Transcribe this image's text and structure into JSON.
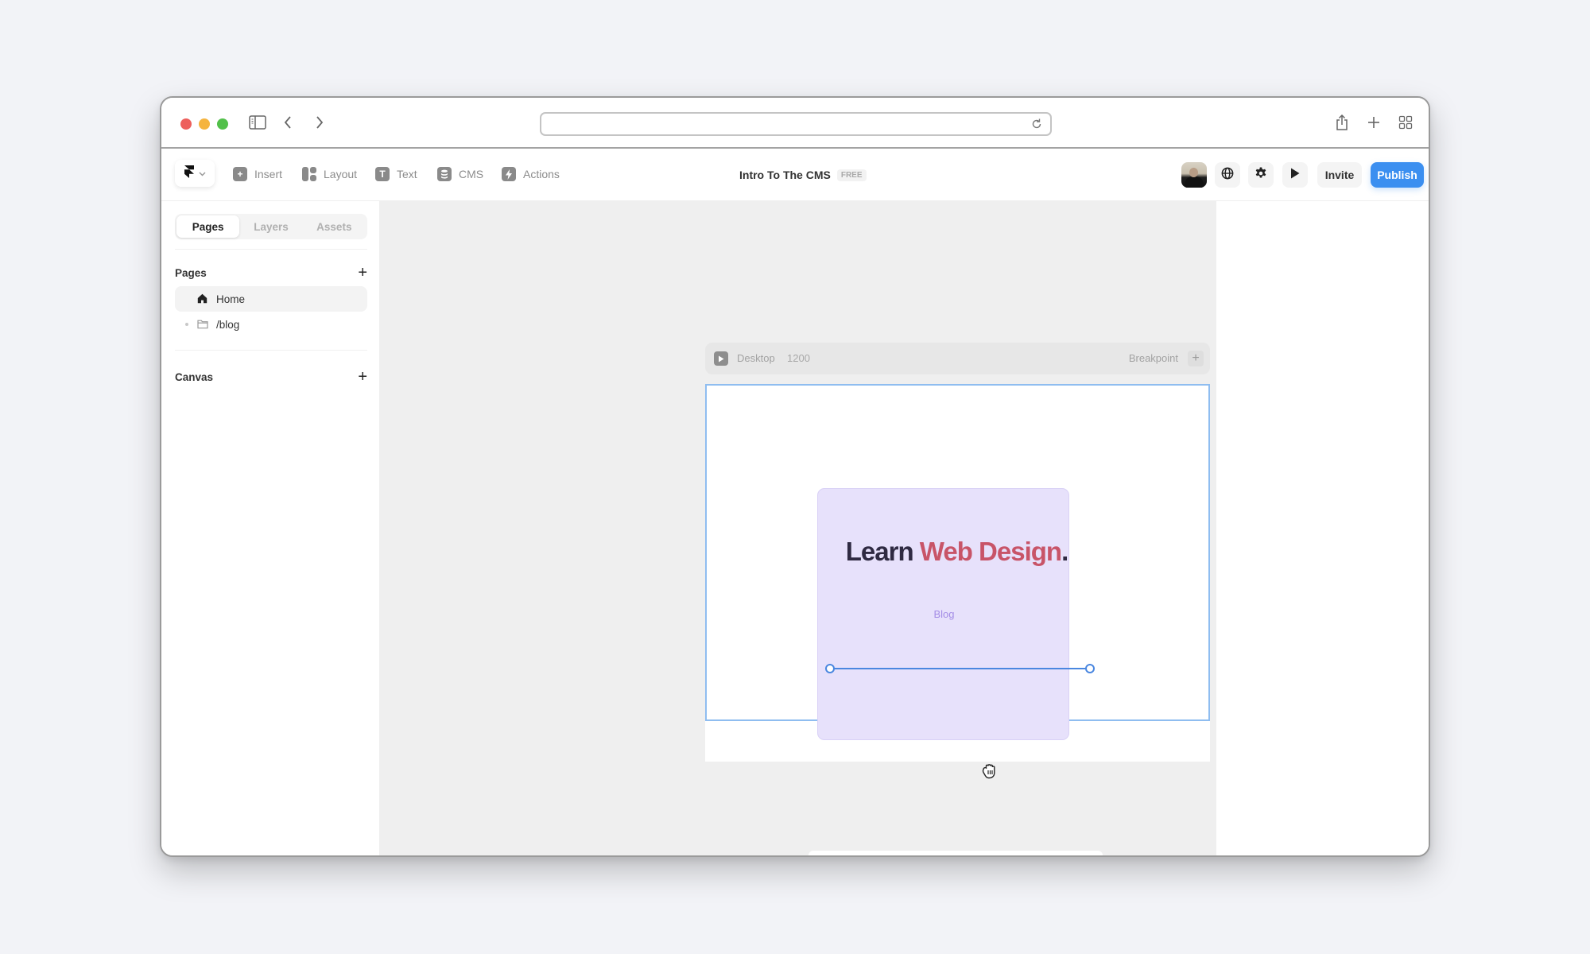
{
  "browser": {
    "url": "",
    "icons": {
      "sidebar": "sidebar-toggle-icon",
      "back": "chevron-left-icon",
      "forward": "chevron-right-icon",
      "reload": "reload-icon",
      "share": "share-icon",
      "new_tab": "plus-icon",
      "tab_overview": "grid-icon"
    }
  },
  "toolbar": {
    "logo_icon": "framer-logo-icon",
    "tools": [
      {
        "label": "Insert",
        "icon": "plus-square-icon"
      },
      {
        "label": "Layout",
        "icon": "layout-icon"
      },
      {
        "label": "Text",
        "icon": "text-icon"
      },
      {
        "label": "CMS",
        "icon": "database-icon"
      },
      {
        "label": "Actions",
        "icon": "bolt-icon"
      }
    ],
    "project_title": "Intro To The CMS",
    "plan_badge": "FREE",
    "invite_label": "Invite",
    "publish_label": "Publish",
    "publish_color": "#3b8ff0"
  },
  "sidebar": {
    "tabs": [
      {
        "label": "Pages",
        "active": true
      },
      {
        "label": "Layers",
        "active": false
      },
      {
        "label": "Assets",
        "active": false
      }
    ],
    "pages_section": {
      "title": "Pages",
      "items": [
        {
          "label": "Home",
          "icon": "home-icon",
          "active": true
        },
        {
          "label": "/blog",
          "icon": "folder-icon",
          "active": false
        }
      ]
    },
    "canvas_section": {
      "title": "Canvas"
    }
  },
  "canvas": {
    "breakpoint": {
      "name": "Desktop",
      "width": "1200",
      "add_label": "Breakpoint"
    },
    "card": {
      "headline_part1": "Learn",
      "headline_part2": "Web Design",
      "headline_part3": ".",
      "link_text": "Blog",
      "accent_color": "#c85468",
      "background_color": "#e7e1fb"
    }
  }
}
